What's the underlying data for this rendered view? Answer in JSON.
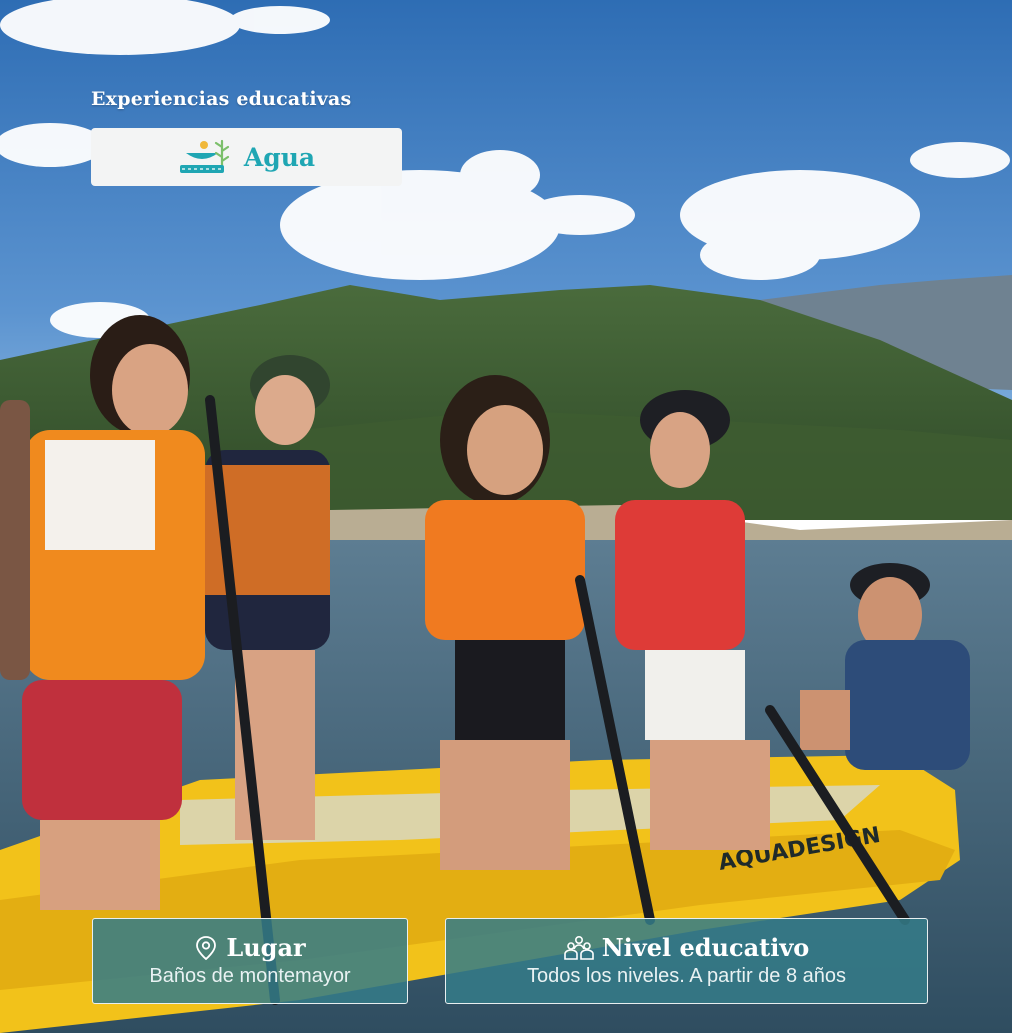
{
  "header": {
    "kicker": "Experiencias educativas",
    "category_label": "Agua",
    "category_icon": "water-landscape-icon"
  },
  "info": {
    "place_title": "Lugar",
    "place_value": "Baños de montemayor",
    "place_icon": "location-pin-icon",
    "level_title": "Nivel educativo",
    "level_value": "Todos los niveles. A partir de 8 años",
    "level_icon": "group-people-icon"
  },
  "photo": {
    "boat_brand": "AQUADESIGN"
  },
  "colors": {
    "accent": "#1fa6b3",
    "card_bg": "#347c88",
    "sky_top": "#2f6fb5",
    "boat_yellow": "#f2c21a"
  }
}
